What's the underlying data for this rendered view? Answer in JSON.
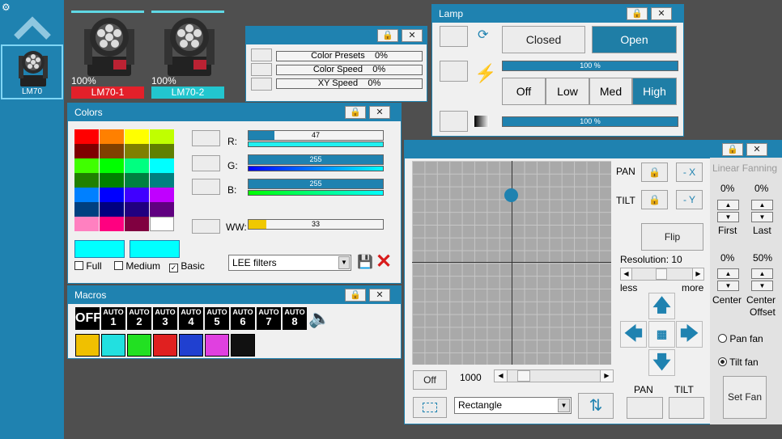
{
  "sidebar": {
    "device_label": "LM70"
  },
  "fixtures": [
    {
      "percent": "100%",
      "label": "LM70-1",
      "color": "#e3202a"
    },
    {
      "percent": "100%",
      "label": "LM70-2",
      "color": "#22c6cf"
    }
  ],
  "presets_window": {
    "rows": [
      {
        "label": "Color Presets",
        "value": "0%"
      },
      {
        "label": "Color Speed",
        "value": "0%"
      },
      {
        "label": "XY Speed",
        "value": "0%"
      }
    ]
  },
  "lamp": {
    "title": "Lamp",
    "closed": "Closed",
    "open": "Open",
    "bar1": "100 %",
    "off": "Off",
    "low": "Low",
    "med": "Med",
    "high": "High",
    "bar2": "100 %"
  },
  "colors": {
    "title": "Colors",
    "r_label": "R:",
    "r_value": "47",
    "g_label": "G:",
    "g_value": "255",
    "b_label": "B:",
    "b_value": "255",
    "ww_label": "WW:",
    "ww_value": "33",
    "full": "Full",
    "medium": "Medium",
    "basic": "Basic",
    "filter": "LEE filters",
    "swatch_color": "#00ffff"
  },
  "macros": {
    "title": "Macros",
    "off": "OFF",
    "auto_top": "AUTO",
    "autos": [
      "1",
      "2",
      "3",
      "4",
      "5",
      "6",
      "7",
      "8"
    ]
  },
  "position": {
    "pan": "PAN",
    "tilt": "TILT",
    "minus_x": "- X",
    "minus_y": "- Y",
    "flip": "Flip",
    "resolution": "Resolution: 10",
    "less": "less",
    "more": "more",
    "off": "Off",
    "speed": "1000",
    "shape": "Rectangle",
    "pan_label": "PAN",
    "tilt_label": "TILT",
    "linear_fanning": "Linear Fanning",
    "first_pct": "0%",
    "last_pct": "0%",
    "first": "First",
    "last": "Last",
    "center_pct": "0%",
    "offset_pct": "50%",
    "center": "Center",
    "center_offset_a": "Center",
    "center_offset_b": "Offset",
    "pan_fan": "Pan fan",
    "tilt_fan": "Tilt fan",
    "set_fan": "Set Fan"
  }
}
